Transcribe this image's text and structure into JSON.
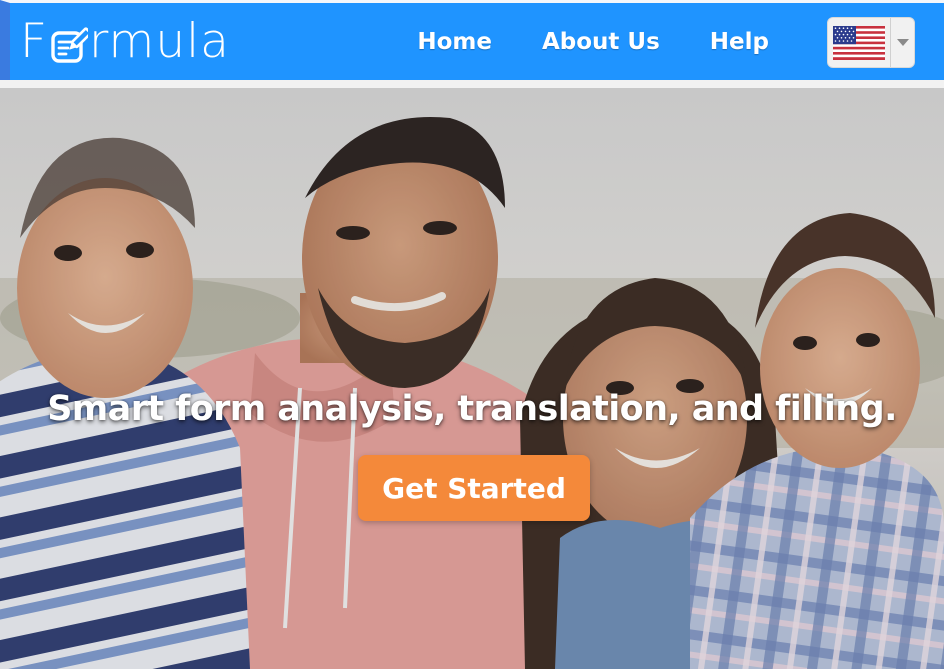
{
  "header": {
    "brand": {
      "logo_prefix": "F",
      "logo_suffix": "rmula",
      "mark_icon": "form-pencil-icon"
    },
    "nav": [
      {
        "label": "Home"
      },
      {
        "label": "About Us"
      },
      {
        "label": "Help"
      }
    ],
    "language_select": {
      "selected_flag_icon": "us-flag-icon",
      "caret_icon": "chevron-down-icon"
    },
    "colors": {
      "bar": "#1f94ff",
      "text": "#ffffff"
    }
  },
  "hero": {
    "headline": "Smart form analysis, translation, and filling.",
    "cta_label": "Get Started",
    "cta_color": "#f4893a",
    "background_icon": "family-photo"
  }
}
